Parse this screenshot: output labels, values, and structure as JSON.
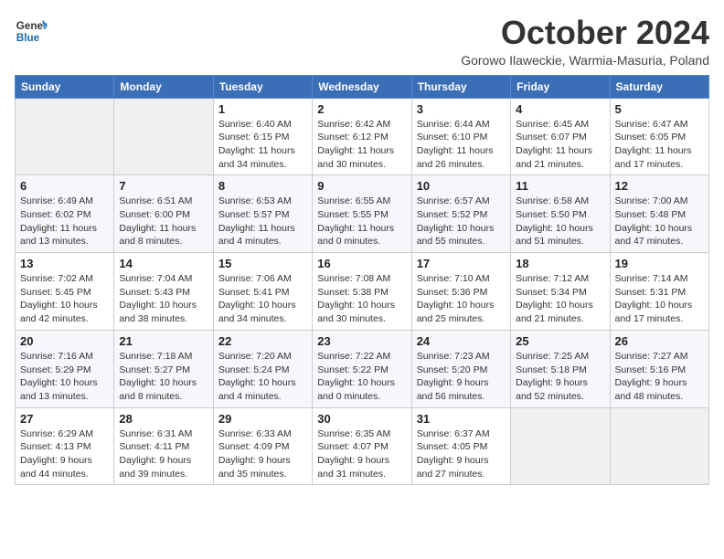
{
  "logo": {
    "line1": "General",
    "line2": "Blue"
  },
  "title": "October 2024",
  "subtitle": "Gorowo Ilaweckie, Warmia-Masuria, Poland",
  "days_of_week": [
    "Sunday",
    "Monday",
    "Tuesday",
    "Wednesday",
    "Thursday",
    "Friday",
    "Saturday"
  ],
  "weeks": [
    [
      {
        "day": "",
        "sunrise": "",
        "sunset": "",
        "daylight": ""
      },
      {
        "day": "",
        "sunrise": "",
        "sunset": "",
        "daylight": ""
      },
      {
        "day": "1",
        "sunrise": "Sunrise: 6:40 AM",
        "sunset": "Sunset: 6:15 PM",
        "daylight": "Daylight: 11 hours and 34 minutes."
      },
      {
        "day": "2",
        "sunrise": "Sunrise: 6:42 AM",
        "sunset": "Sunset: 6:12 PM",
        "daylight": "Daylight: 11 hours and 30 minutes."
      },
      {
        "day": "3",
        "sunrise": "Sunrise: 6:44 AM",
        "sunset": "Sunset: 6:10 PM",
        "daylight": "Daylight: 11 hours and 26 minutes."
      },
      {
        "day": "4",
        "sunrise": "Sunrise: 6:45 AM",
        "sunset": "Sunset: 6:07 PM",
        "daylight": "Daylight: 11 hours and 21 minutes."
      },
      {
        "day": "5",
        "sunrise": "Sunrise: 6:47 AM",
        "sunset": "Sunset: 6:05 PM",
        "daylight": "Daylight: 11 hours and 17 minutes."
      }
    ],
    [
      {
        "day": "6",
        "sunrise": "Sunrise: 6:49 AM",
        "sunset": "Sunset: 6:02 PM",
        "daylight": "Daylight: 11 hours and 13 minutes."
      },
      {
        "day": "7",
        "sunrise": "Sunrise: 6:51 AM",
        "sunset": "Sunset: 6:00 PM",
        "daylight": "Daylight: 11 hours and 8 minutes."
      },
      {
        "day": "8",
        "sunrise": "Sunrise: 6:53 AM",
        "sunset": "Sunset: 5:57 PM",
        "daylight": "Daylight: 11 hours and 4 minutes."
      },
      {
        "day": "9",
        "sunrise": "Sunrise: 6:55 AM",
        "sunset": "Sunset: 5:55 PM",
        "daylight": "Daylight: 11 hours and 0 minutes."
      },
      {
        "day": "10",
        "sunrise": "Sunrise: 6:57 AM",
        "sunset": "Sunset: 5:52 PM",
        "daylight": "Daylight: 10 hours and 55 minutes."
      },
      {
        "day": "11",
        "sunrise": "Sunrise: 6:58 AM",
        "sunset": "Sunset: 5:50 PM",
        "daylight": "Daylight: 10 hours and 51 minutes."
      },
      {
        "day": "12",
        "sunrise": "Sunrise: 7:00 AM",
        "sunset": "Sunset: 5:48 PM",
        "daylight": "Daylight: 10 hours and 47 minutes."
      }
    ],
    [
      {
        "day": "13",
        "sunrise": "Sunrise: 7:02 AM",
        "sunset": "Sunset: 5:45 PM",
        "daylight": "Daylight: 10 hours and 42 minutes."
      },
      {
        "day": "14",
        "sunrise": "Sunrise: 7:04 AM",
        "sunset": "Sunset: 5:43 PM",
        "daylight": "Daylight: 10 hours and 38 minutes."
      },
      {
        "day": "15",
        "sunrise": "Sunrise: 7:06 AM",
        "sunset": "Sunset: 5:41 PM",
        "daylight": "Daylight: 10 hours and 34 minutes."
      },
      {
        "day": "16",
        "sunrise": "Sunrise: 7:08 AM",
        "sunset": "Sunset: 5:38 PM",
        "daylight": "Daylight: 10 hours and 30 minutes."
      },
      {
        "day": "17",
        "sunrise": "Sunrise: 7:10 AM",
        "sunset": "Sunset: 5:36 PM",
        "daylight": "Daylight: 10 hours and 25 minutes."
      },
      {
        "day": "18",
        "sunrise": "Sunrise: 7:12 AM",
        "sunset": "Sunset: 5:34 PM",
        "daylight": "Daylight: 10 hours and 21 minutes."
      },
      {
        "day": "19",
        "sunrise": "Sunrise: 7:14 AM",
        "sunset": "Sunset: 5:31 PM",
        "daylight": "Daylight: 10 hours and 17 minutes."
      }
    ],
    [
      {
        "day": "20",
        "sunrise": "Sunrise: 7:16 AM",
        "sunset": "Sunset: 5:29 PM",
        "daylight": "Daylight: 10 hours and 13 minutes."
      },
      {
        "day": "21",
        "sunrise": "Sunrise: 7:18 AM",
        "sunset": "Sunset: 5:27 PM",
        "daylight": "Daylight: 10 hours and 8 minutes."
      },
      {
        "day": "22",
        "sunrise": "Sunrise: 7:20 AM",
        "sunset": "Sunset: 5:24 PM",
        "daylight": "Daylight: 10 hours and 4 minutes."
      },
      {
        "day": "23",
        "sunrise": "Sunrise: 7:22 AM",
        "sunset": "Sunset: 5:22 PM",
        "daylight": "Daylight: 10 hours and 0 minutes."
      },
      {
        "day": "24",
        "sunrise": "Sunrise: 7:23 AM",
        "sunset": "Sunset: 5:20 PM",
        "daylight": "Daylight: 9 hours and 56 minutes."
      },
      {
        "day": "25",
        "sunrise": "Sunrise: 7:25 AM",
        "sunset": "Sunset: 5:18 PM",
        "daylight": "Daylight: 9 hours and 52 minutes."
      },
      {
        "day": "26",
        "sunrise": "Sunrise: 7:27 AM",
        "sunset": "Sunset: 5:16 PM",
        "daylight": "Daylight: 9 hours and 48 minutes."
      }
    ],
    [
      {
        "day": "27",
        "sunrise": "Sunrise: 6:29 AM",
        "sunset": "Sunset: 4:13 PM",
        "daylight": "Daylight: 9 hours and 44 minutes."
      },
      {
        "day": "28",
        "sunrise": "Sunrise: 6:31 AM",
        "sunset": "Sunset: 4:11 PM",
        "daylight": "Daylight: 9 hours and 39 minutes."
      },
      {
        "day": "29",
        "sunrise": "Sunrise: 6:33 AM",
        "sunset": "Sunset: 4:09 PM",
        "daylight": "Daylight: 9 hours and 35 minutes."
      },
      {
        "day": "30",
        "sunrise": "Sunrise: 6:35 AM",
        "sunset": "Sunset: 4:07 PM",
        "daylight": "Daylight: 9 hours and 31 minutes."
      },
      {
        "day": "31",
        "sunrise": "Sunrise: 6:37 AM",
        "sunset": "Sunset: 4:05 PM",
        "daylight": "Daylight: 9 hours and 27 minutes."
      },
      {
        "day": "",
        "sunrise": "",
        "sunset": "",
        "daylight": ""
      },
      {
        "day": "",
        "sunrise": "",
        "sunset": "",
        "daylight": ""
      }
    ]
  ]
}
